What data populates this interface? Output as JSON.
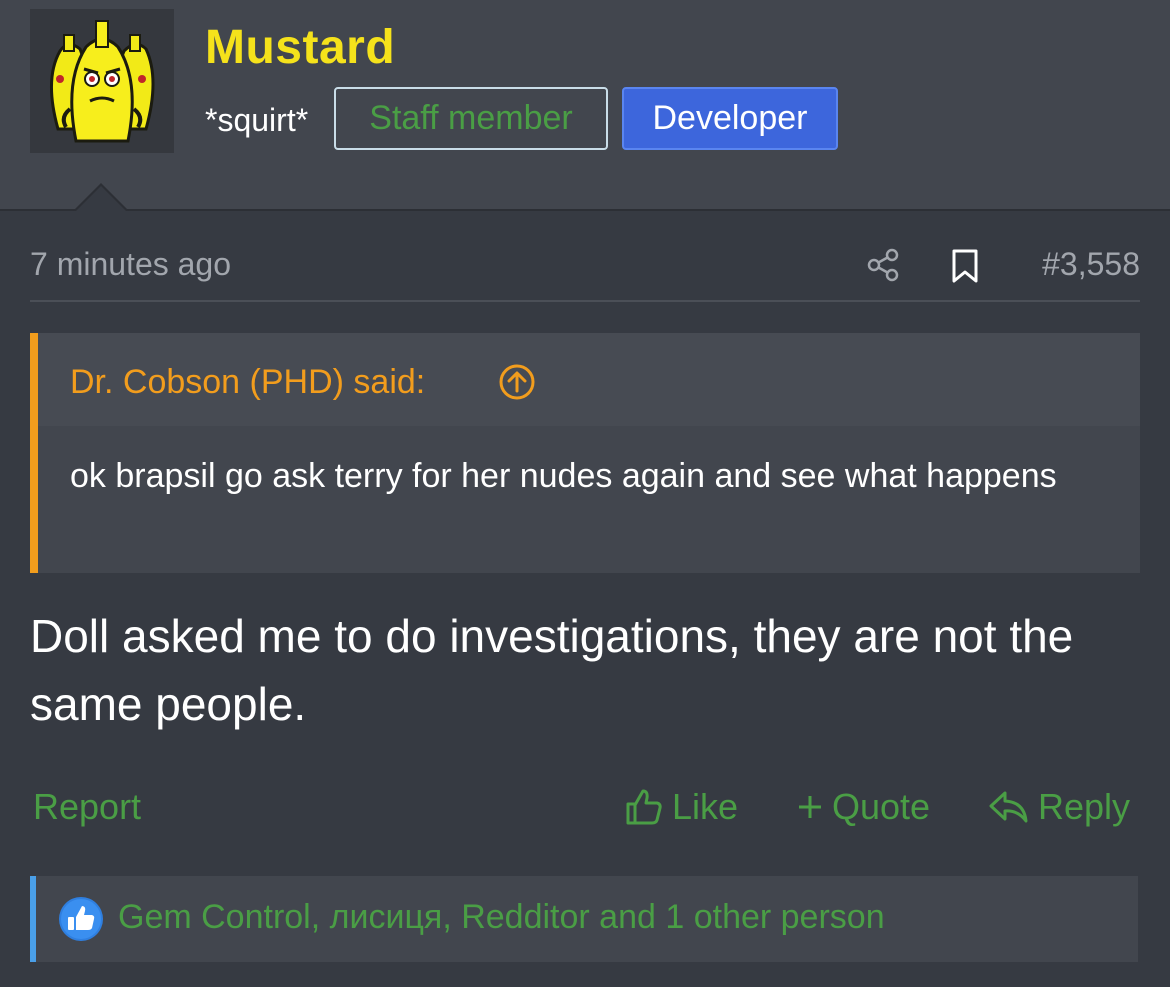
{
  "user": {
    "name": "Mustard",
    "title": "*squirt*",
    "badges": {
      "staff": "Staff member",
      "developer": "Developer"
    }
  },
  "post": {
    "time": "7 minutes ago",
    "number": "#3,558",
    "quote": {
      "author": "Dr. Cobson (PHD) said:",
      "text": "ok brapsil go ask terry for her nudes again and see what happens"
    },
    "message": "Doll asked me to do investigations, they are not the same people."
  },
  "actions": {
    "report": "Report",
    "like": "Like",
    "quote": "Quote",
    "reply": "Reply"
  },
  "reactions": {
    "text": "Gem Control, лисиця, Redditor and 1 other person",
    "icon": "thumbs-up-icon"
  },
  "colors": {
    "username": "#f5e21b",
    "accent_green": "#4a9e45",
    "quote_orange": "#f29d1d",
    "developer_blue": "#3d66dc",
    "reaction_blue": "#4a9fe8"
  }
}
